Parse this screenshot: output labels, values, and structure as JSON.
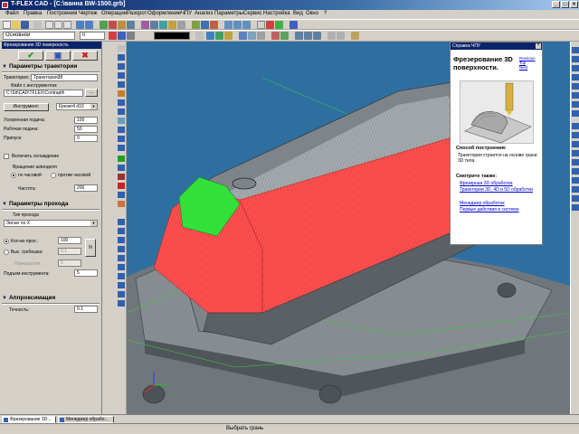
{
  "window": {
    "title": "T-FLEX CAD - [C:\\ванна BW-1500.grb]",
    "buttons": [
      "_",
      "□",
      "×"
    ]
  },
  "menu": [
    "Файл",
    "Правка",
    "Построения",
    "Чертеж",
    "Операции",
    "Разорот",
    "Оформление",
    "ЧПУ",
    "Анализ",
    "Параметры",
    "Сервис",
    "Настройка",
    "Вид",
    "Окно",
    "?"
  ],
  "toolbar2": {
    "layer_value": "Основной",
    "value_field": "0"
  },
  "panel": {
    "title": "Фрезерование 3D поверхность",
    "ok": "✔",
    "save": "▣",
    "cancel": "✖",
    "sec1": {
      "title": "Параметры траектории",
      "trajectory_label": "Траектория:",
      "trajectory_value": "Траектория38",
      "tool_file_label": "Файл с инструментом",
      "tool_file_path": "C:\\Sit\\CAD\\TFLEX\\Сontrapth",
      "tool_file_btn": "...",
      "tool_btn": "Инструмент:",
      "tool_value": "Fрезеr4 d10",
      "feed_fast_label": "Ускоренная подача:",
      "feed_fast_value": "100",
      "feed_work_label": "Рабочая подача:",
      "feed_work_value": "50",
      "allowance_label": "Припуск:",
      "allowance_value": "0",
      "cooling_label": "Включить охлаждение",
      "spindle_label": "Вращение шпинделя",
      "spindle_cw": "по часовой",
      "spindle_ccw": "против часовой",
      "freq_label": "Частота:",
      "freq_value": "200"
    },
    "sec2": {
      "title": "Параметры прохода",
      "pass_type_label": "Тип прохода",
      "pass_type_value": "Зигзаг по X",
      "count_label": "Кол-во прох.:",
      "count_value": "100",
      "depth_label": "Выс. гребешка:",
      "depth_value": "0.1",
      "step_label": "Перекрытие:",
      "step_value": "0",
      "side_btn": "N",
      "lift_label": "Подъем инструмента:",
      "lift_value": "5"
    },
    "sec3": {
      "title": "Аппроксимация",
      "accuracy_label": "Точность:",
      "accuracy_value": "0.1"
    }
  },
  "help": {
    "window_title": "Справка ЧПУ",
    "close": "×",
    "heading": "Фрезерование 3D поверхности.",
    "links_top": [
      "Previous",
      "Top",
      "Next"
    ],
    "method_title": "Способ построения:",
    "method_text": "Траектория строится на основе грани 3D тела.",
    "see_also_title": "Смотрите также:",
    "see_also": [
      "Фрезерная 3D обработка",
      "Траектории 3D, 4D и 5D обработки",
      "Менеджер обработок",
      "Первые действия в системе"
    ]
  },
  "tabs": [
    "Фрезерование 3D...",
    "Менеджер обрабо..."
  ],
  "status": "Выбрать грань",
  "colors": {
    "viewport_bg": "#2e6fa0",
    "face_red": "#ff4a4a",
    "face_green": "#33e03a",
    "body_gray": "#7f8488"
  }
}
